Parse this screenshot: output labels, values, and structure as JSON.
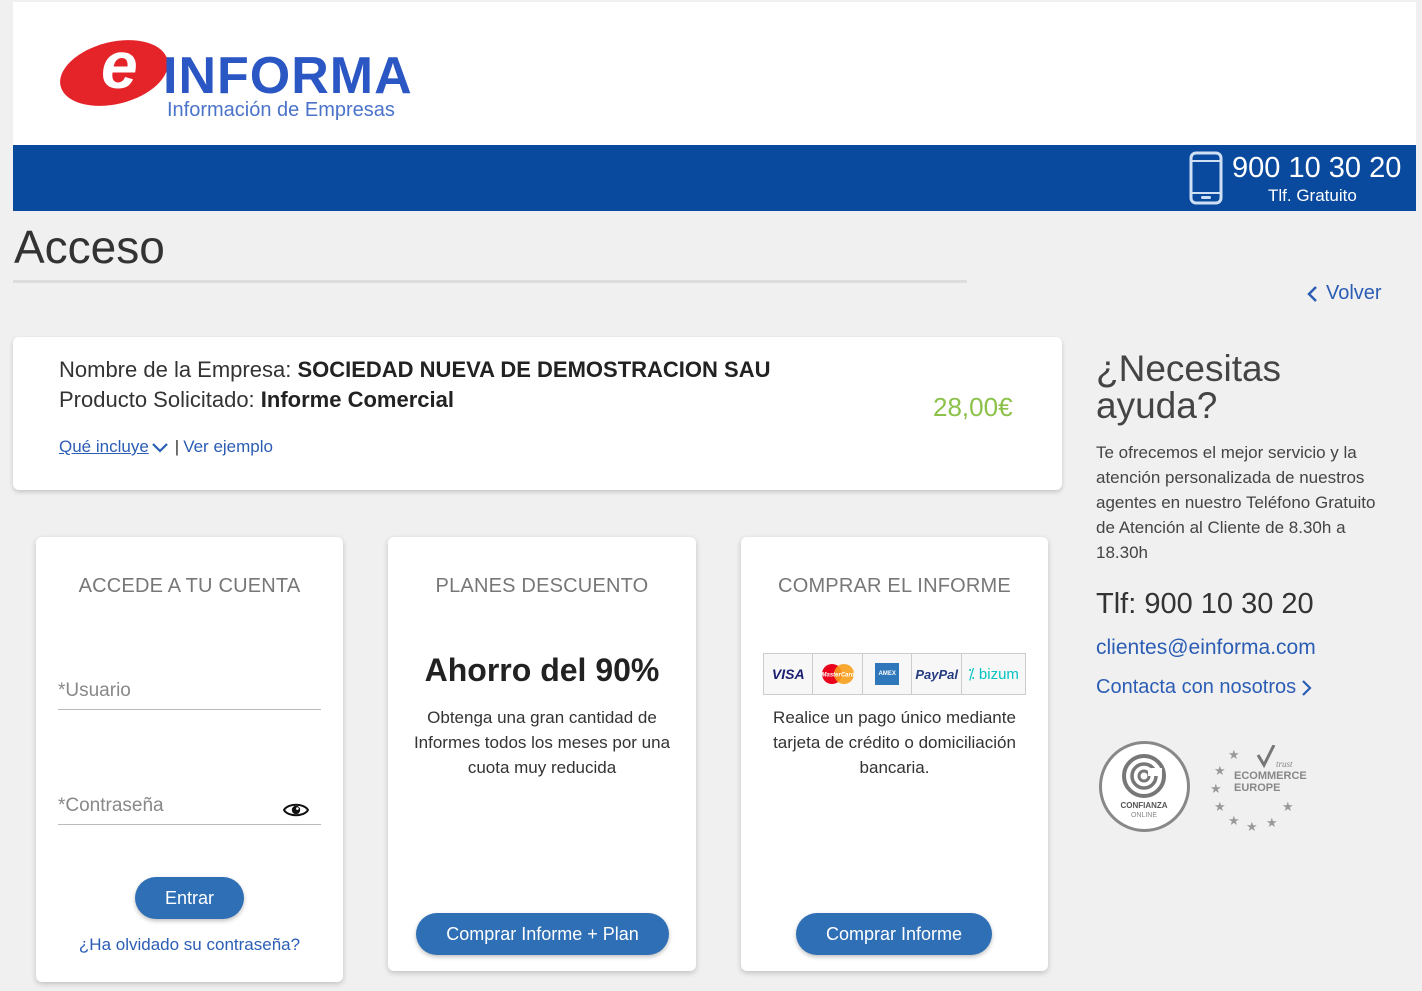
{
  "brand": {
    "logo_letter": "e",
    "logo_word": "INFORMA",
    "logo_subtitle": "Información de Empresas"
  },
  "topbar": {
    "phone_number": "900 10 30 20",
    "phone_caption": "Tlf. Gratuito"
  },
  "page": {
    "title": "Acceso",
    "back_label": "Volver"
  },
  "product": {
    "company_label": "Nombre de la Empresa: ",
    "company_value": "SOCIEDAD NUEVA DE DEMOSTRACION SAU",
    "product_label": "Producto Solicitado: ",
    "product_value": "Informe Comercial",
    "price": "28,00€",
    "includes_link": "Qué incluye",
    "separator": "|",
    "example_link": "Ver ejemplo"
  },
  "login": {
    "title": "ACCEDE A TU CUENTA",
    "user_placeholder": "*Usuario",
    "password_placeholder": "*Contraseña",
    "submit_label": "Entrar",
    "forgot_link": "¿Ha olvidado su contraseña?"
  },
  "plans": {
    "title": "PLANES DESCUENTO",
    "headline": "Ahorro del 90%",
    "description": "Obtenga una gran cantidad de Informes todos los meses por una cuota muy reducida",
    "button_label": "Comprar Informe + Plan"
  },
  "purchase": {
    "title": "COMPRAR EL INFORME",
    "payment_methods": [
      "VISA",
      "MasterCard",
      "AMEX",
      "PayPal",
      "bizum"
    ],
    "description": "Realice un pago único mediante tarjeta de crédito o domiciliación bancaria.",
    "button_label": "Comprar Informe"
  },
  "help": {
    "title": "¿Necesitas ayuda?",
    "text": "Te ofrecemos el mejor servicio y la atención personalizada de nuestros agentes en nuestro Teléfono Gratuito de Atención al Cliente de 8.30h a 18.30h",
    "phone": "Tlf: 900 10 30 20",
    "email": "clientes@einforma.com",
    "contact_link": "Contacta con nosotros"
  },
  "seals": {
    "confianza_top": "CONFIANZA",
    "confianza_bottom": "ONLINE",
    "ecommerce_trust": "trust",
    "ecommerce_line1": "ECOMMERCE",
    "ecommerce_line2": "EUROPE"
  },
  "colors": {
    "brand_blue": "#0a4a9e",
    "brand_red": "#e5242a",
    "link_blue": "#2b5db5",
    "button_blue": "#2f6fb5",
    "price_green": "#8cc24a"
  }
}
